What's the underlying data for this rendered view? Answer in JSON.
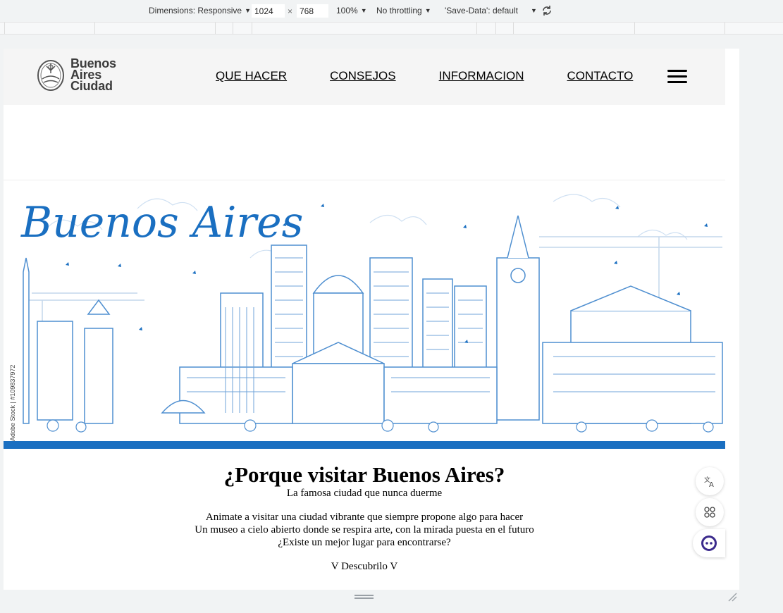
{
  "devtools": {
    "dimensions_label": "Dimensions: Responsive",
    "width": "1024",
    "times": "×",
    "height": "768",
    "zoom": "100%",
    "throttling": "No throttling",
    "save_data": "'Save-Data': default"
  },
  "site": {
    "logo": {
      "line1": "Buenos",
      "line2": "Aires",
      "line3": "Ciudad"
    },
    "nav": [
      "QUE HACER",
      "CONSEJOS",
      "INFORMACION",
      "CONTACTO"
    ],
    "hero": {
      "title": "Buenos Aires",
      "watermark": "Adobe Stock | #109837972",
      "accent_color": "#1a6fc1",
      "line_color": "#7fb0e0"
    },
    "heading": "¿Porque visitar Buenos Aires?",
    "subtitle": "La famosa ciudad que nunca duerme",
    "lines": [
      "Animate a visitar una ciudad vibrante que siempre propone algo para hacer",
      "Un museo a cielo abierto donde se respira arte, con la mirada puesta en el futuro",
      "¿Existe un mejor lugar para encontrarse?"
    ],
    "cta": "V Descubrilo V"
  },
  "floating": {
    "translate_icon": "translate-icon",
    "apps_icon": "apps-icon",
    "assistant_icon": "assistant-icon"
  }
}
